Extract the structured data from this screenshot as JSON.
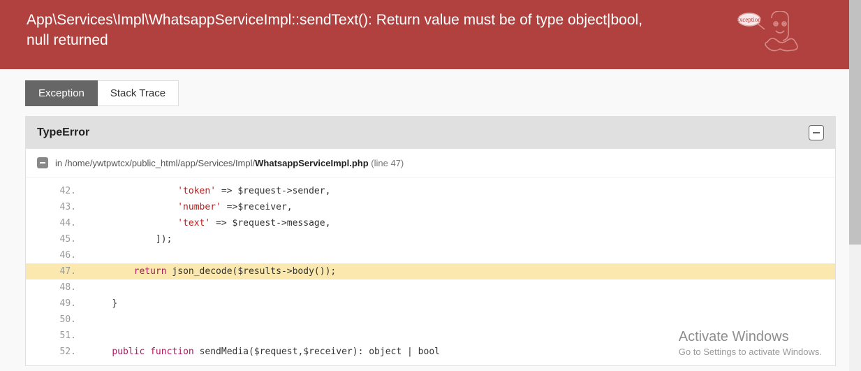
{
  "header": {
    "title": "App\\Services\\Impl\\WhatsappServiceImpl::sendText(): Return value must be of type object|bool, null returned"
  },
  "tabs": {
    "exception": "Exception",
    "stack": "Stack Trace"
  },
  "error": {
    "type": "TypeError",
    "path_prefix": "in /home/ywtpwtcx/public_html/app/Services/Impl/",
    "path_file": "WhatsappServiceImpl.php",
    "line_label": " (line 47)"
  },
  "code": [
    {
      "n": "42.",
      "indent": "                ",
      "tokens": [
        {
          "t": "s",
          "v": "'token'"
        },
        {
          "t": "p",
          "v": " => "
        },
        {
          "t": "v",
          "v": "$request->sender"
        },
        {
          "t": "p",
          "v": ","
        }
      ]
    },
    {
      "n": "43.",
      "indent": "                ",
      "tokens": [
        {
          "t": "s",
          "v": "'number'"
        },
        {
          "t": "p",
          "v": " =>"
        },
        {
          "t": "v",
          "v": "$receiver"
        },
        {
          "t": "p",
          "v": ","
        }
      ]
    },
    {
      "n": "44.",
      "indent": "                ",
      "tokens": [
        {
          "t": "s",
          "v": "'text'"
        },
        {
          "t": "p",
          "v": " => "
        },
        {
          "t": "v",
          "v": "$request->message"
        },
        {
          "t": "p",
          "v": ","
        }
      ]
    },
    {
      "n": "45.",
      "indent": "            ",
      "tokens": [
        {
          "t": "p",
          "v": "]);"
        }
      ]
    },
    {
      "n": "46.",
      "indent": "",
      "tokens": []
    },
    {
      "n": "47.",
      "hl": true,
      "indent": "        ",
      "tokens": [
        {
          "t": "k",
          "v": "return"
        },
        {
          "t": "p",
          "v": " "
        },
        {
          "t": "fn",
          "v": "json_decode"
        },
        {
          "t": "p",
          "v": "("
        },
        {
          "t": "v",
          "v": "$results->body()"
        },
        {
          "t": "p",
          "v": ");"
        }
      ]
    },
    {
      "n": "48.",
      "indent": "",
      "tokens": []
    },
    {
      "n": "49.",
      "indent": "    ",
      "tokens": [
        {
          "t": "p",
          "v": "}"
        }
      ]
    },
    {
      "n": "50.",
      "indent": "",
      "tokens": []
    },
    {
      "n": "51.",
      "indent": "",
      "tokens": []
    },
    {
      "n": "52.",
      "indent": "    ",
      "tokens": [
        {
          "t": "k",
          "v": "public"
        },
        {
          "t": "p",
          "v": " "
        },
        {
          "t": "k",
          "v": "function"
        },
        {
          "t": "p",
          "v": " "
        },
        {
          "t": "fn",
          "v": "sendMedia"
        },
        {
          "t": "p",
          "v": "("
        },
        {
          "t": "v",
          "v": "$request"
        },
        {
          "t": "p",
          "v": ","
        },
        {
          "t": "v",
          "v": "$receiver"
        },
        {
          "t": "p",
          "v": "): object | bool"
        }
      ]
    }
  ],
  "watermark": {
    "line1": "Activate Windows",
    "line2": "Go to Settings to activate Windows."
  }
}
